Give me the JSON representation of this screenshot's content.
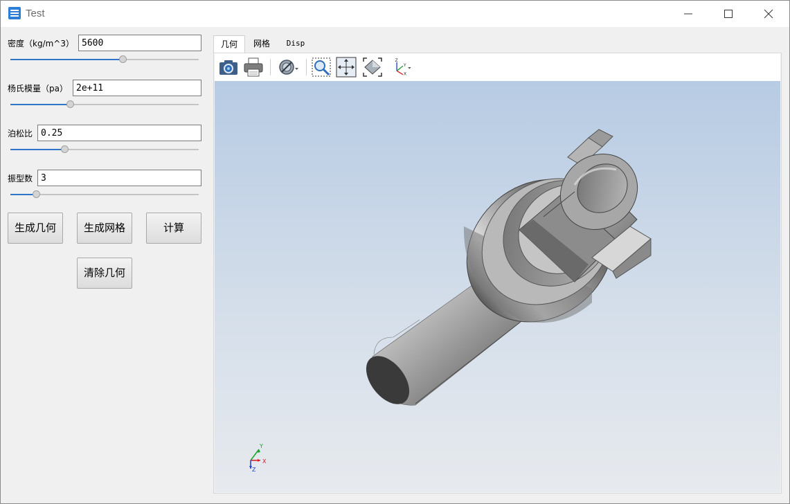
{
  "window": {
    "title": "Test"
  },
  "params": [
    {
      "label": "密度（kg/m^3）",
      "value": "5600",
      "slider_fraction": 0.6
    },
    {
      "label": "杨氏模量（pa）",
      "value": "2e+11",
      "slider_fraction": 0.32
    },
    {
      "label": "泊松比",
      "value": "0.25",
      "slider_fraction": 0.29
    },
    {
      "label": "振型数",
      "value": "3",
      "slider_fraction": 0.14
    }
  ],
  "buttons": {
    "gen_geometry": "生成几何",
    "gen_mesh": "生成网格",
    "compute": "计算",
    "clear_geometry": "清除几何"
  },
  "tabs": [
    {
      "label": "几何",
      "active": true
    },
    {
      "label": "网格",
      "active": false
    },
    {
      "label": "Disp",
      "active": false
    }
  ],
  "toolbar_icons": [
    "camera-icon",
    "print-icon",
    "section-plane-icon",
    "zoom-window-icon",
    "pan-icon",
    "fit-all-icon",
    "axis-orientation-icon"
  ],
  "axis_triad": {
    "x": "X",
    "y": "Y",
    "z": "Z"
  },
  "colors": {
    "accent": "#2e75c7",
    "viewport_top": "#b7cbe3",
    "viewport_bottom": "#e7eaee"
  }
}
